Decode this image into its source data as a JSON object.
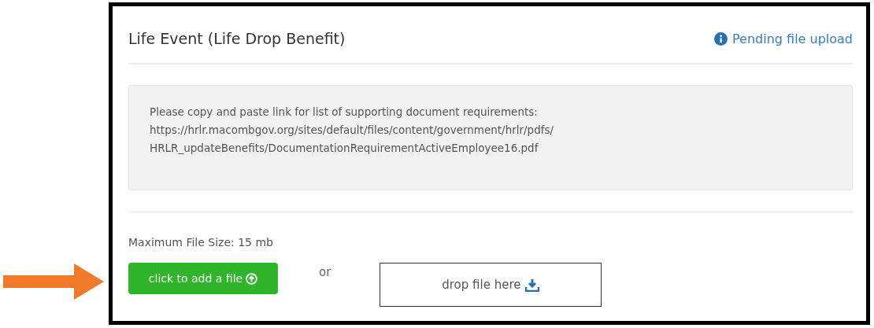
{
  "panel": {
    "title": "Life Event (Life Drop Benefit)",
    "status": "Pending file upload"
  },
  "notice": {
    "lines": [
      "Please copy and paste link for list of supporting document requirements:",
      "https://hrlr.macombgov.org/sites/default/files/content/government/hrlr/pdfs/",
      "HRLR_updateBenefits/DocumentationRequirementActiveEmployee16.pdf"
    ]
  },
  "upload": {
    "max_size": "Maximum File Size: 15 mb",
    "add_button": "click to add a file",
    "separator": "or",
    "drop_zone": "drop file here"
  }
}
